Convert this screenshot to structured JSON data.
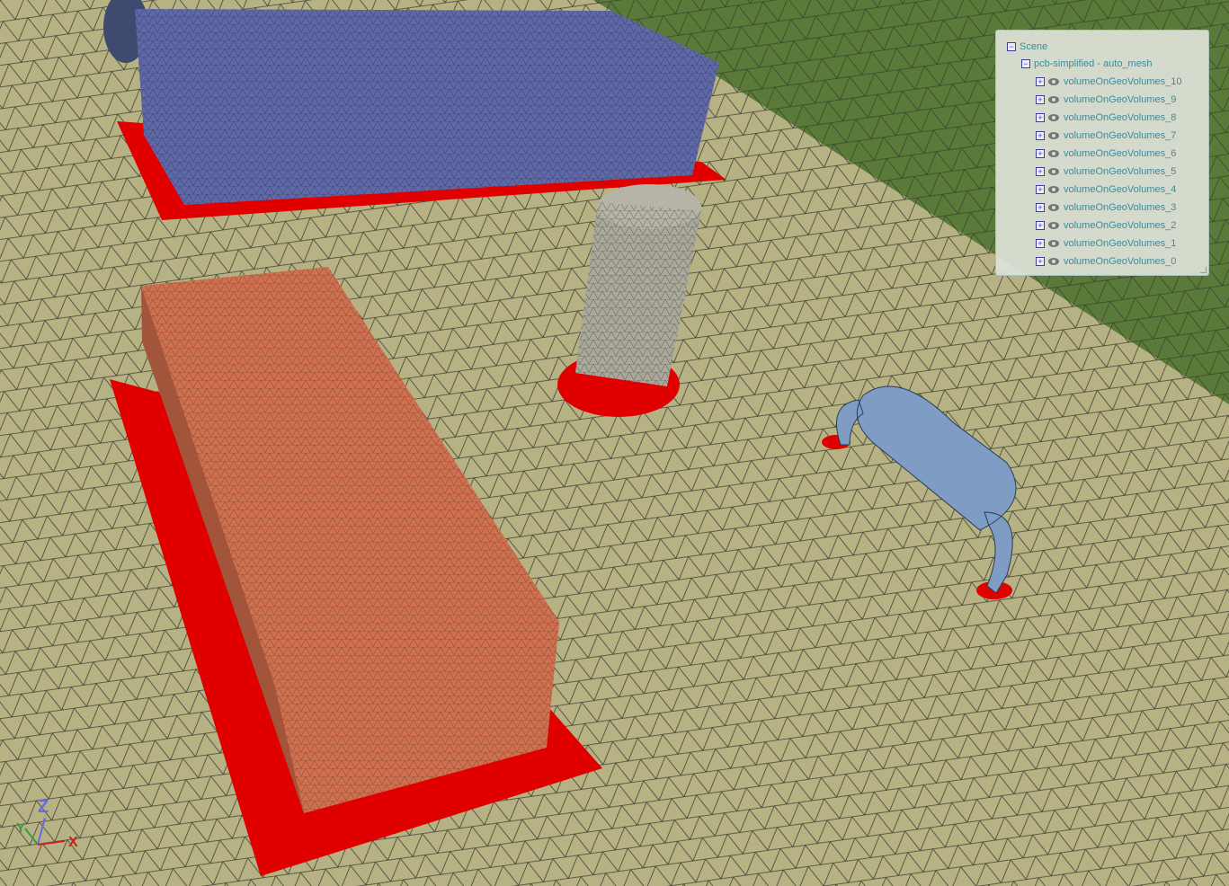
{
  "scene_tree": {
    "root": "Scene",
    "model": "pcb-simplified - auto_mesh",
    "items": [
      "volumeOnGeoVolumes_10",
      "volumeOnGeoVolumes_9",
      "volumeOnGeoVolumes_8",
      "volumeOnGeoVolumes_7",
      "volumeOnGeoVolumes_6",
      "volumeOnGeoVolumes_5",
      "volumeOnGeoVolumes_4",
      "volumeOnGeoVolumes_3",
      "volumeOnGeoVolumes_2",
      "volumeOnGeoVolumes_1",
      "volumeOnGeoVolumes_0"
    ]
  },
  "axes": {
    "x": "X",
    "y": "Y",
    "z": "Z"
  },
  "colors": {
    "floor": "#b6b283",
    "wall": "#5a7a3a",
    "blue_box": "#5f68a8",
    "orange_box": "#d0704f",
    "pad": "#e00000",
    "cylinder": "#a9a89a",
    "capacitor": "#7e9cc4"
  }
}
